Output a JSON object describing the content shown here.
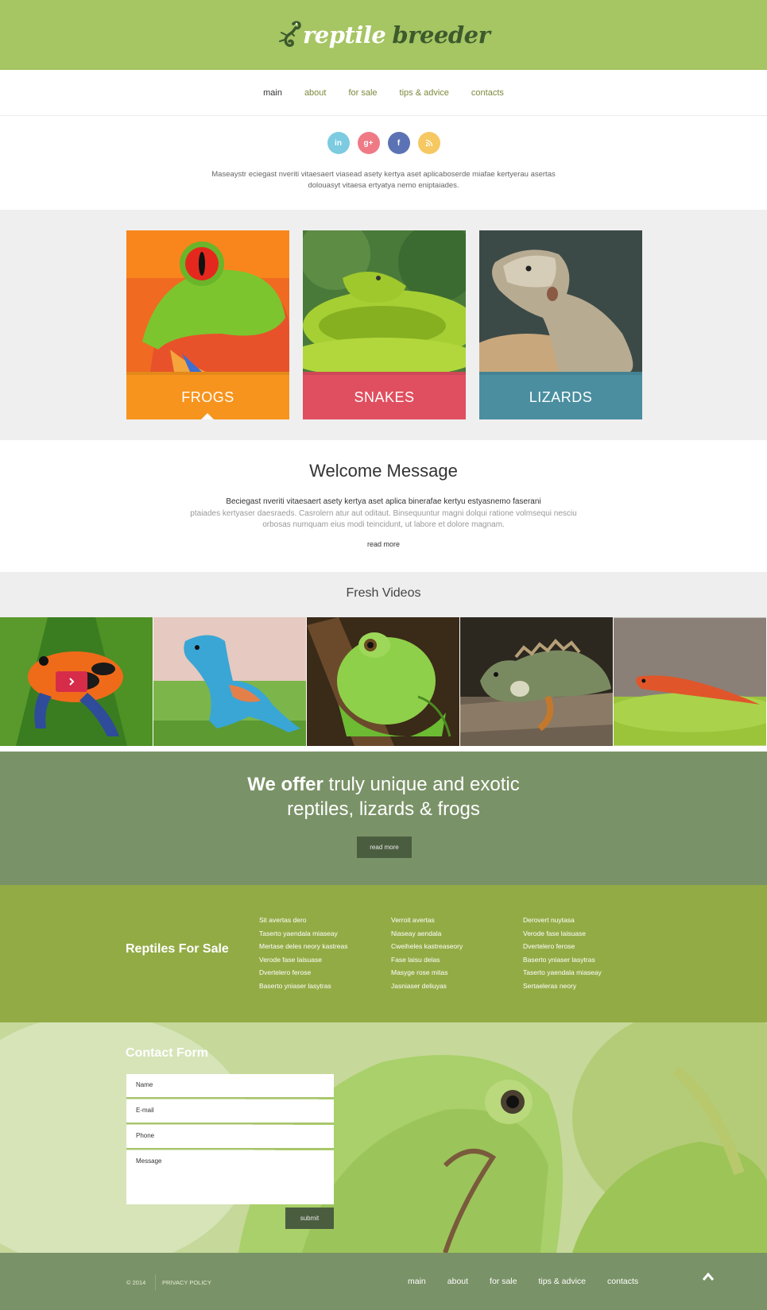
{
  "header": {
    "logo_word1": "reptile",
    "logo_word2": "breeder",
    "bg_color": "#a6c563"
  },
  "nav": {
    "items": [
      {
        "label": "main",
        "active": true
      },
      {
        "label": "about"
      },
      {
        "label": "for sale"
      },
      {
        "label": "tips & advice"
      },
      {
        "label": "contacts"
      }
    ]
  },
  "social": {
    "linkedin": "in",
    "googleplus": "g+",
    "facebook": "f",
    "rss": "rss-icon"
  },
  "intro": {
    "text": "Maseaystr eciegast nveriti vitaesaert viasead asety kertya aset aplicaboserde miafae kertyerau asertas dolouasyt vitaesa ertyatya nemo eniptaiades."
  },
  "categories": [
    {
      "label": "FROGS",
      "color": "#f7941d"
    },
    {
      "label": "SNAKES",
      "color": "#e04f5f"
    },
    {
      "label": "LIZARDS",
      "color": "#4a8ea0"
    }
  ],
  "welcome": {
    "title": "Welcome Message",
    "lead": "Beciegast nveriti vitaesaert asety kertya aset aplica binerafae kertyu estyasnemo faserani",
    "body": "ptaiades kertyaser daesraeds. Casrolern atur aut oditaut. Binsequuntur magni dolqui ratione volmsequi nesciu orbosas numquam eius modi teincidunt, ut labore et dolore magnam.",
    "more": "read more"
  },
  "videos": {
    "title": "Fresh Videos"
  },
  "offer": {
    "bold": "We offer",
    "line1_rest": " truly unique and exotic",
    "line2": "reptiles, lizards & frogs",
    "button": "read more"
  },
  "sale": {
    "title": "Reptiles For Sale",
    "col1": [
      "Sit avertas dero",
      "Taserto yaendala miaseay",
      "Mertase deles neory kastreas",
      "Verode fase laisuase",
      "Dvertelero ferose",
      "Baserto yniaser lasytras"
    ],
    "col2": [
      "Verroit avertas",
      "Niaseay aendala",
      "Cweiheles kastreaseory",
      "Fase laisu delas",
      "Masyge rose mitas",
      "Jasniaser deliuyas"
    ],
    "col3": [
      "Derovert nuytasa",
      "Verode fase laisuase",
      "Dvertelero ferose",
      "Baserto yniaser lasytras",
      "Taserto yaendala miaseay",
      "Sertaeleras neory"
    ]
  },
  "contact": {
    "title": "Contact Form",
    "name_placeholder": "Name",
    "email_placeholder": "E-mail",
    "phone_placeholder": "Phone",
    "message_placeholder": "Message",
    "submit": "submit"
  },
  "footer": {
    "copyright": "© 2014",
    "privacy": "PRIVACY POLICY",
    "nav": [
      "main",
      "about",
      "for sale",
      "tips & advice",
      "contacts"
    ],
    "bg_color": "#7a9267"
  }
}
